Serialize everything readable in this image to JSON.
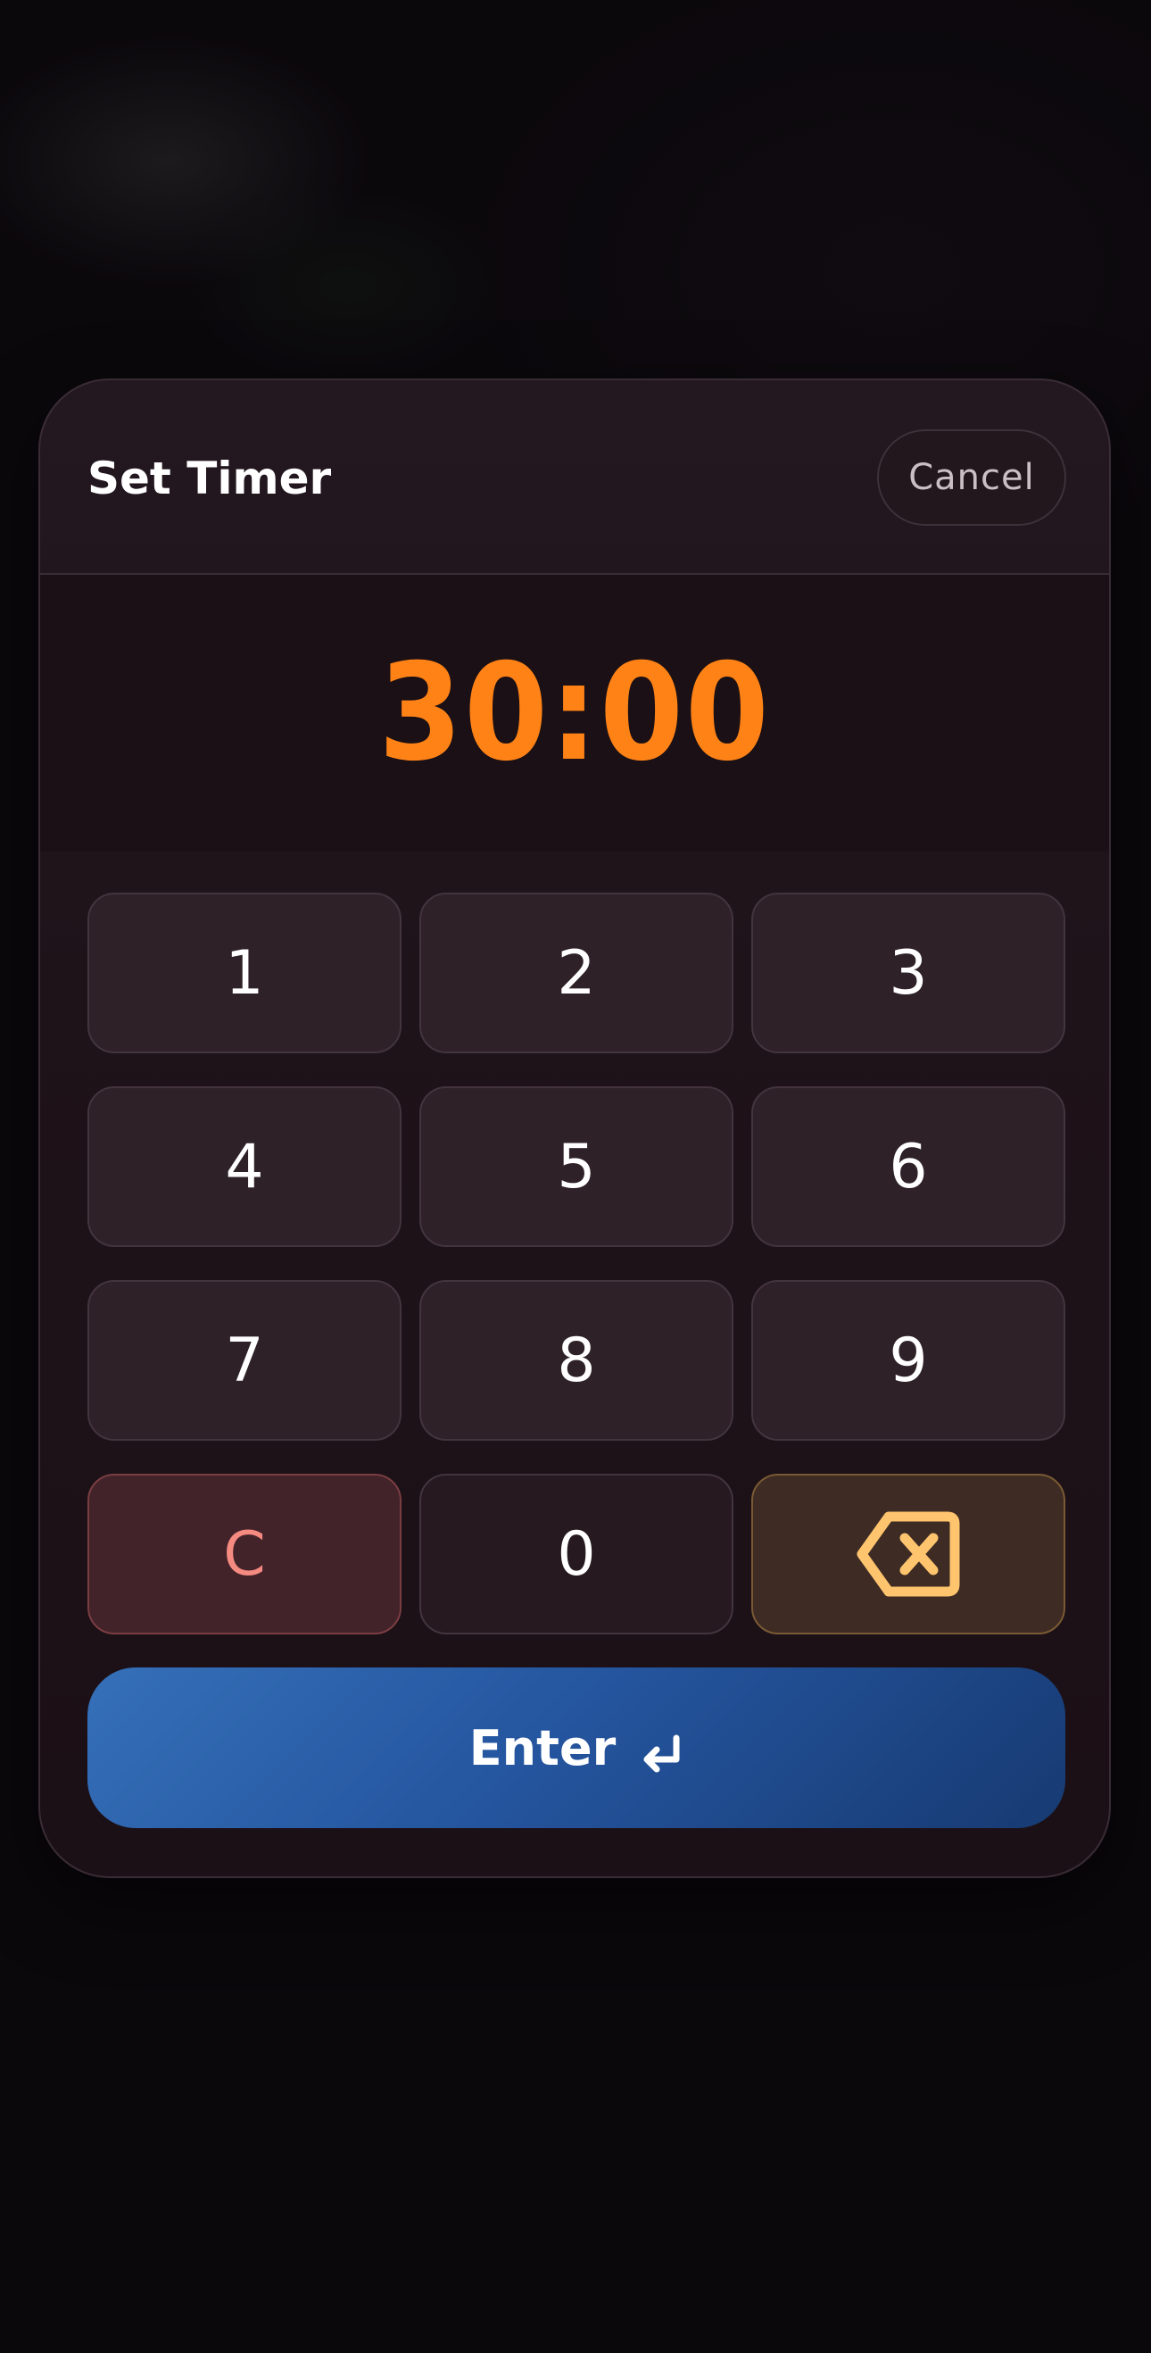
{
  "dialog": {
    "title": "Set Timer",
    "cancel_label": "Cancel",
    "time_display": "30:00"
  },
  "keypad": {
    "keys": [
      "1",
      "2",
      "3",
      "4",
      "5",
      "6",
      "7",
      "8",
      "9"
    ],
    "clear_label": "C",
    "zero_label": "0",
    "backspace_icon": "backspace-icon"
  },
  "enter": {
    "label": "Enter",
    "icon": "return-arrow-icon"
  },
  "colors": {
    "time_accent": "#ff8216",
    "clear_text": "#f58a80",
    "backspace_icon": "#ffc46e",
    "enter_blue": "#2556a0"
  }
}
